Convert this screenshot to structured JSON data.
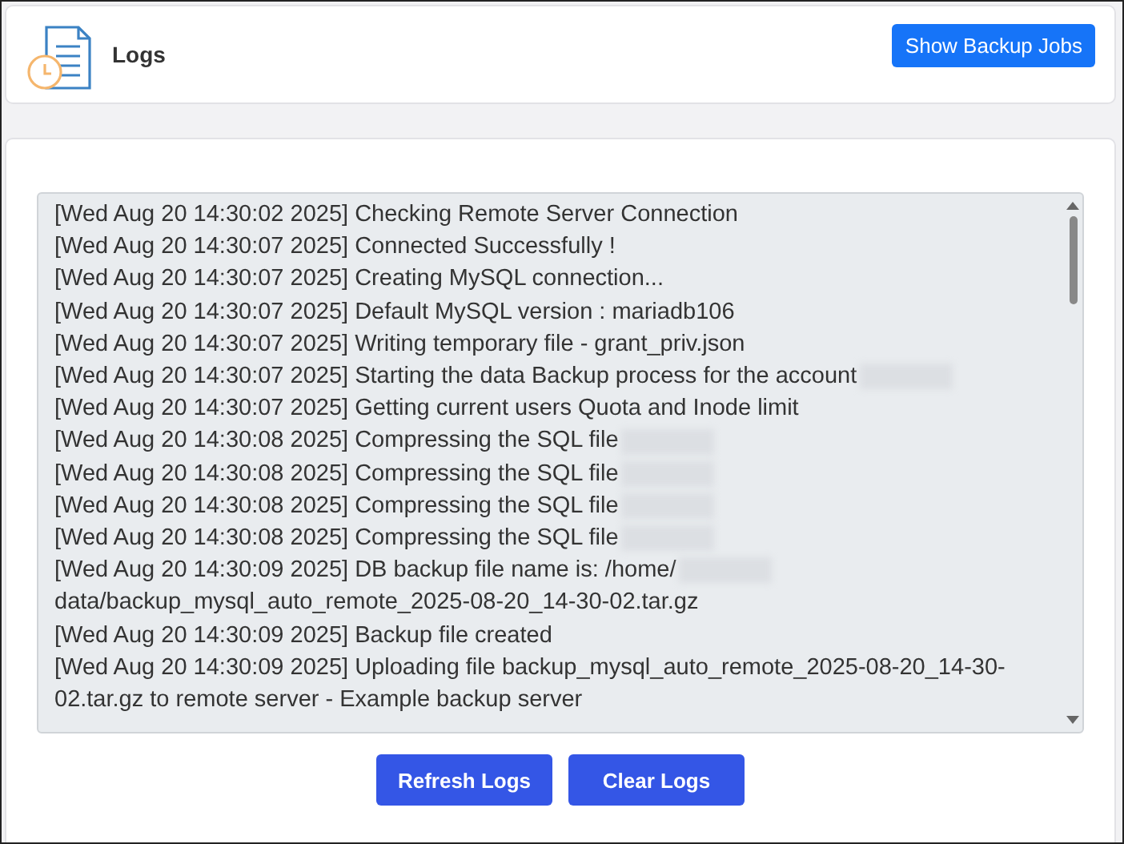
{
  "header": {
    "title": "Logs",
    "button": "Show Backup Jobs"
  },
  "log_lines": [
    {
      "text": "[Wed Aug 20 14:30:02 2025] Checking Remote Server Connection",
      "redacted": false
    },
    {
      "text": "[Wed Aug 20 14:30:07 2025] Connected Successfully !",
      "redacted": false
    },
    {
      "text": "[Wed Aug 20 14:30:07 2025] Creating MySQL connection...",
      "redacted": false
    },
    {
      "text": "[Wed Aug 20 14:30:07 2025] Default MySQL version : mariadb106",
      "redacted": false
    },
    {
      "text": "[Wed Aug 20 14:30:07 2025] Writing temporary file - grant_priv.json",
      "redacted": false
    },
    {
      "text": "[Wed Aug 20 14:30:07 2025] Starting the data Backup process for the account",
      "redacted": true
    },
    {
      "text": "[Wed Aug 20 14:30:07 2025] Getting current users Quota and Inode limit",
      "redacted": false
    },
    {
      "text": "[Wed Aug 20 14:30:08 2025] Compressing the SQL file",
      "redacted": true
    },
    {
      "text": "[Wed Aug 20 14:30:08 2025] Compressing the SQL file",
      "redacted": true
    },
    {
      "text": "[Wed Aug 20 14:30:08 2025] Compressing the SQL file",
      "redacted": true
    },
    {
      "text": "[Wed Aug 20 14:30:08 2025] Compressing the SQL file",
      "redacted": true
    },
    {
      "text": "[Wed Aug 20 14:30:09 2025] DB backup file name is: /home/",
      "redacted": true,
      "tail": "data/backup_mysql_auto_remote_2025-08-20_14-30-02.tar.gz"
    },
    {
      "text": "[Wed Aug 20 14:30:09 2025] Backup file created",
      "redacted": false
    },
    {
      "text": "[Wed Aug 20 14:30:09 2025] Uploading file backup_mysql_auto_remote_2025-08-20_14-30-02.tar.gz to remote server - Example backup server",
      "redacted": false
    }
  ],
  "buttons": [
    "Refresh Logs",
    "Clear Logs"
  ]
}
